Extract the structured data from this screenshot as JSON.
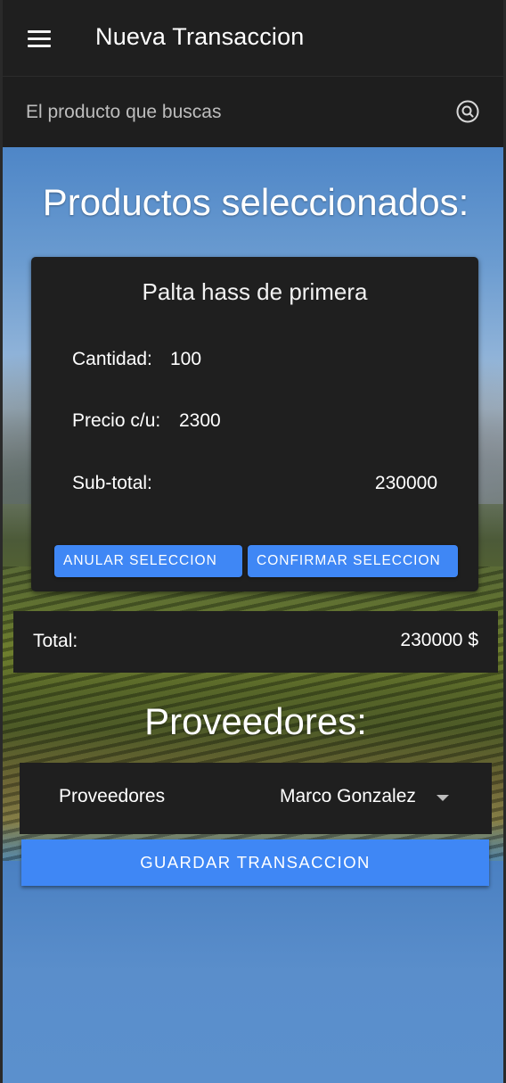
{
  "header": {
    "title": "Nueva Transaccion"
  },
  "search": {
    "placeholder": "El producto que buscas"
  },
  "products": {
    "heading": "Productos seleccionados:",
    "items": [
      {
        "name": "Palta hass de primera",
        "quantity_label": "Cantidad:",
        "quantity": "100",
        "unit_price_label": "Precio c/u:",
        "unit_price": "2300",
        "subtotal_label": "Sub-total:",
        "subtotal": "230000",
        "cancel_label": "ANULAR SELECCION",
        "confirm_label": "CONFIRMAR SELECCION"
      }
    ]
  },
  "total": {
    "label": "Total:",
    "value": "230000 $"
  },
  "providers": {
    "heading": "Proveedores:",
    "field_label": "Proveedores",
    "selected": "Marco Gonzalez"
  },
  "actions": {
    "save_label": "GUARDAR TRANSACCION"
  },
  "colors": {
    "accent": "#3f87f5",
    "surface": "#1f1f1f"
  },
  "icons": {
    "menu": "menu-icon",
    "search": "search-icon",
    "dropdown": "chevron-down-icon"
  }
}
